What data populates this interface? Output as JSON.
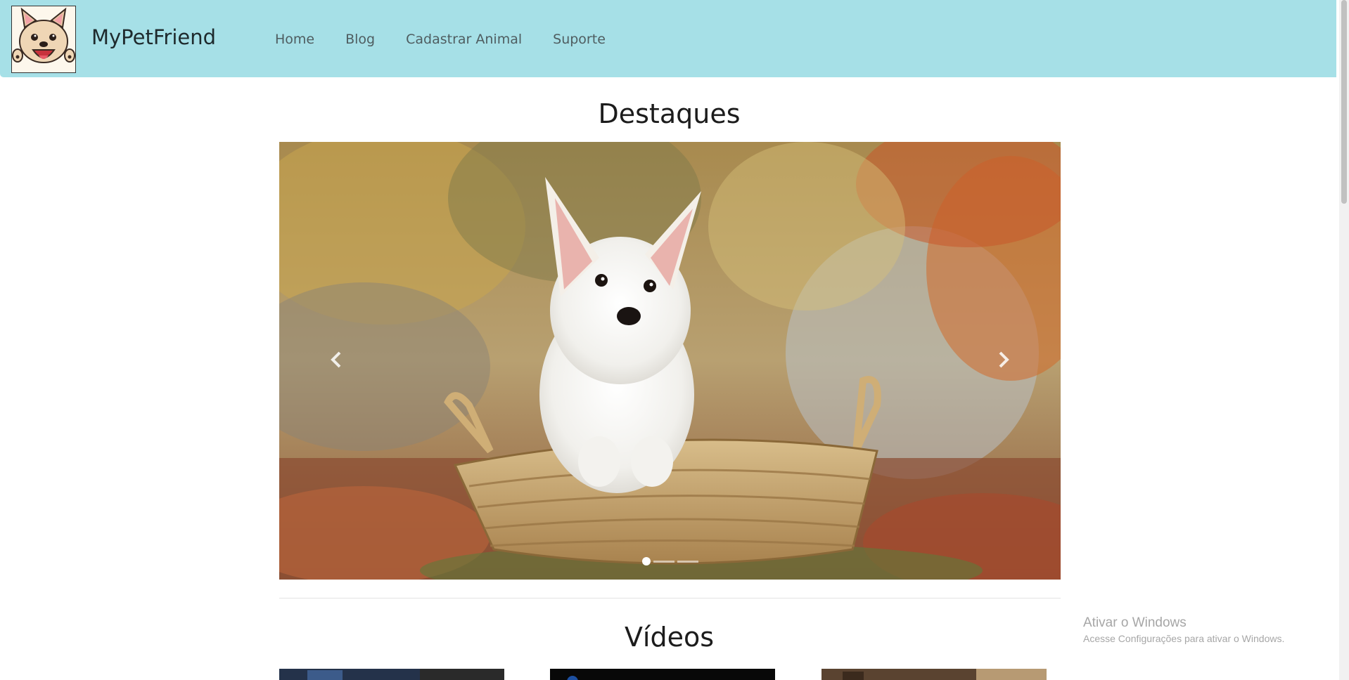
{
  "navbar": {
    "brand": "MyPetFriend",
    "logo_icon": "french-bulldog-logo-icon",
    "links": [
      "Home",
      "Blog",
      "Cadastrar Animal",
      "Suporte"
    ],
    "background": "#a6e0e7"
  },
  "highlights": {
    "title": "Destaques",
    "carousel": {
      "prev_icon": "chevron-left-icon",
      "next_icon": "chevron-right-icon",
      "slide_count": 3,
      "active_slide": 1,
      "image": "white-puppy-in-basket-autumn-leaves"
    }
  },
  "videos": {
    "title": "Vídeos",
    "thumbnails": [
      "video-thumbnail-1",
      "video-thumbnail-2",
      "video-thumbnail-3"
    ]
  },
  "os_watermark": {
    "title": "Ativar o Windows",
    "subtitle": "Acesse Configurações para ativar o Windows."
  }
}
